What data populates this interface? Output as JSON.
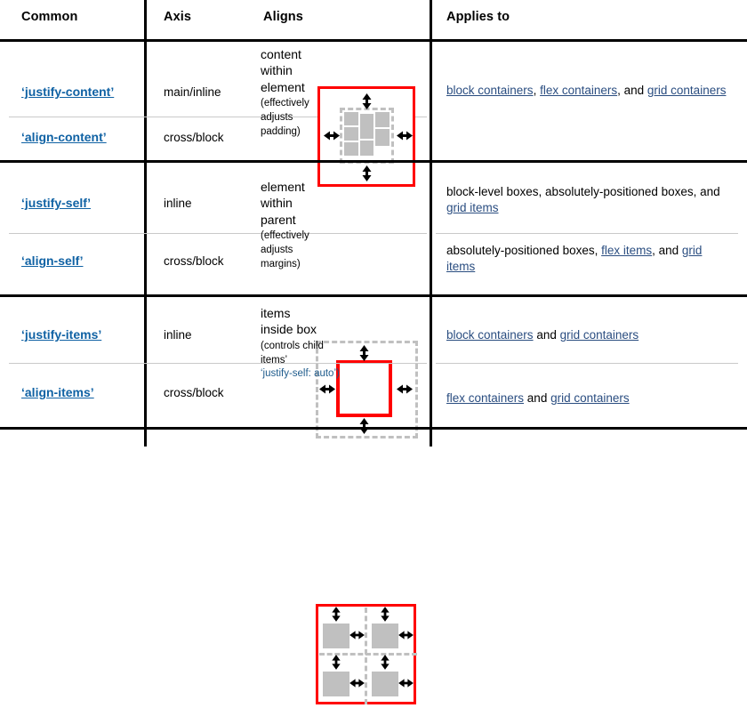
{
  "table": {
    "headers": {
      "common": "Common",
      "axis": "Axis",
      "aligns": "Aligns",
      "applies_to": "Applies to"
    },
    "sections": [
      {
        "id": "content",
        "aligns_main": "content within element",
        "aligns_note": "(effectively adjusts padding)",
        "diagram": "content-within-element-diagram",
        "rows": [
          {
            "property": "‘justify-content’",
            "axis": "main/inline",
            "applies_to_parts": [
              {
                "text": "block containers",
                "link": true
              },
              {
                "text": ", ",
                "link": false
              },
              {
                "text": "flex containers",
                "link": true
              },
              {
                "text": ", and ",
                "link": false
              },
              {
                "text": "grid containers",
                "link": true
              }
            ]
          },
          {
            "property": "‘align-content’",
            "axis": "cross/block",
            "applies_to_parts": []
          }
        ]
      },
      {
        "id": "self",
        "aligns_main": "element within parent",
        "aligns_note": "(effectively adjusts margins)",
        "diagram": "element-within-parent-diagram",
        "rows": [
          {
            "property": "‘justify-self’",
            "axis": "inline",
            "applies_to_parts": [
              {
                "text": "block-level boxes, absolutely-positioned boxes, and ",
                "link": false
              },
              {
                "text": "grid items",
                "link": true
              }
            ]
          },
          {
            "property": "‘align-self’",
            "axis": "cross/block",
            "applies_to_parts": [
              {
                "text": "absolutely-positioned boxes, ",
                "link": false
              },
              {
                "text": "flex items",
                "link": true
              },
              {
                "text": ", and ",
                "link": false
              },
              {
                "text": "grid items",
                "link": true
              }
            ]
          }
        ]
      },
      {
        "id": "items",
        "aligns_main": "items inside box",
        "aligns_note": "(controls child items’",
        "aligns_note_code": "‘justify-self: auto’)",
        "diagram": "items-inside-box-diagram",
        "rows": [
          {
            "property": "‘justify-items’",
            "axis": "inline",
            "applies_to_parts": [
              {
                "text": "block containers",
                "link": true
              },
              {
                "text": " and ",
                "link": false
              },
              {
                "text": "grid containers",
                "link": true
              }
            ]
          },
          {
            "property": "‘align-items’",
            "axis": "cross/block",
            "applies_to_parts": [
              {
                "text": "flex containers",
                "link": true
              },
              {
                "text": " and ",
                "link": false
              },
              {
                "text": "grid containers",
                "link": true
              }
            ]
          }
        ]
      }
    ]
  },
  "colors": {
    "property_link": "#1062a4",
    "applies_link": "#2a4d80",
    "diagram_red": "#ff0000",
    "diagram_gray": "#c0c0c0",
    "rule_black": "#000000",
    "rule_light": "#c9c9c9",
    "code_blue": "#1e5b8c"
  }
}
